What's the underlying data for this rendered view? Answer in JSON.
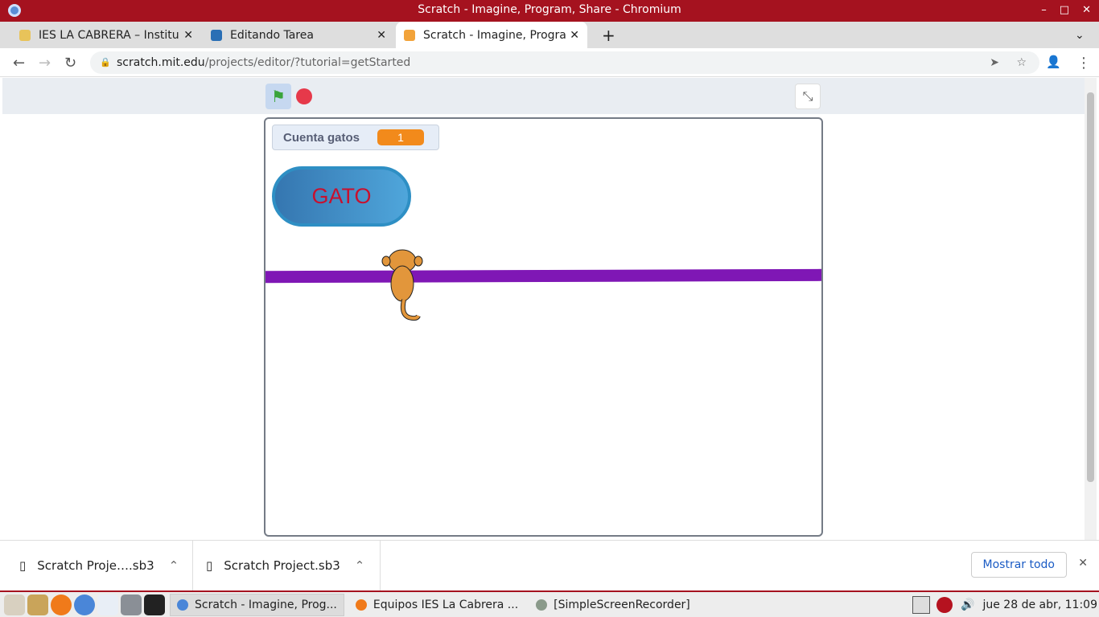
{
  "window": {
    "title": "Scratch - Imagine, Program, Share - Chromium",
    "controls": [
      "–",
      "□",
      "✕"
    ]
  },
  "tabs": [
    {
      "label": "IES LA CABRERA – Institu",
      "active": false
    },
    {
      "label": "Editando Tarea",
      "active": false
    },
    {
      "label": "Scratch - Imagine, Progra",
      "active": true
    }
  ],
  "new_tab": "+",
  "address": {
    "domain": "scratch.mit.edu",
    "path": "/projects/editor/?tutorial=getStarted"
  },
  "stage": {
    "monitor_label": "Cuenta gatos",
    "monitor_value": "1",
    "button_label": "GATO"
  },
  "downloads": {
    "items": [
      "Scratch Proje….sb3",
      "Scratch Project.sb3"
    ],
    "show_all": "Mostrar todo"
  },
  "taskbar": {
    "tasks": [
      "Scratch - Imagine, Prog...",
      "Equipos IES La Cabrera ...",
      "[SimpleScreenRecorder]"
    ],
    "clock": "jue 28 de abr, 11:09"
  },
  "colors": {
    "titlebar": "#a5121f",
    "line": "#7f17b5",
    "monitor_value": "#f28a1b",
    "gato_text": "#c8102e"
  }
}
